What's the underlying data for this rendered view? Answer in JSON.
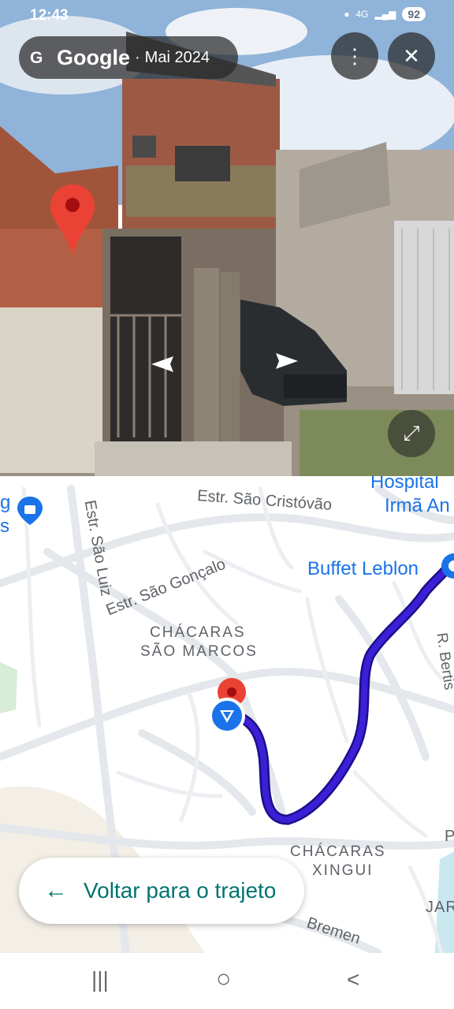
{
  "status_bar": {
    "time": "12:43",
    "network": "4G",
    "battery": "92"
  },
  "header": {
    "brand": "Google",
    "separator": "·",
    "date": "Mai 2024"
  },
  "icons": {
    "google_logo": "google-g-icon",
    "more": "more-vert-icon",
    "close": "close-icon",
    "expand": "expand-icon",
    "nav_left": "chevron-left-icon",
    "nav_right": "chevron-right-icon",
    "pin": "location-pin-icon",
    "back_arrow": "arrow-left-icon"
  },
  "map": {
    "labels": {
      "hospital_line1": "Hospital",
      "hospital_line2": "Irmã An",
      "estr_sao_cristovao": "Estr. São Cristóvão",
      "estr_sao_luiz": "Estr. São Luiz",
      "estr_sao_goncalo": "Estr. São Gonçalo",
      "chacaras_sao_marcos_line1": "CHÁCARAS",
      "chacaras_sao_marcos_line2": "SÃO MARCOS",
      "buffet": "Buffet Leblon",
      "r_bertis": "R. Bertis",
      "chacaras_xingui_line1": "CHÁCARAS",
      "chacaras_xingui_line2": "XINGUI",
      "bremen": "Bremen",
      "left_edge_g": "g",
      "left_edge_s": "s",
      "jar": "JAR",
      "p": "P"
    },
    "colors": {
      "route": "#3d1fd6",
      "marker": "#1a73e8",
      "pin": "#ea4335"
    }
  },
  "back_button": {
    "label": "Voltar para o trajeto"
  },
  "system_nav": {
    "recents": "|||",
    "home": "○",
    "back": "<"
  }
}
